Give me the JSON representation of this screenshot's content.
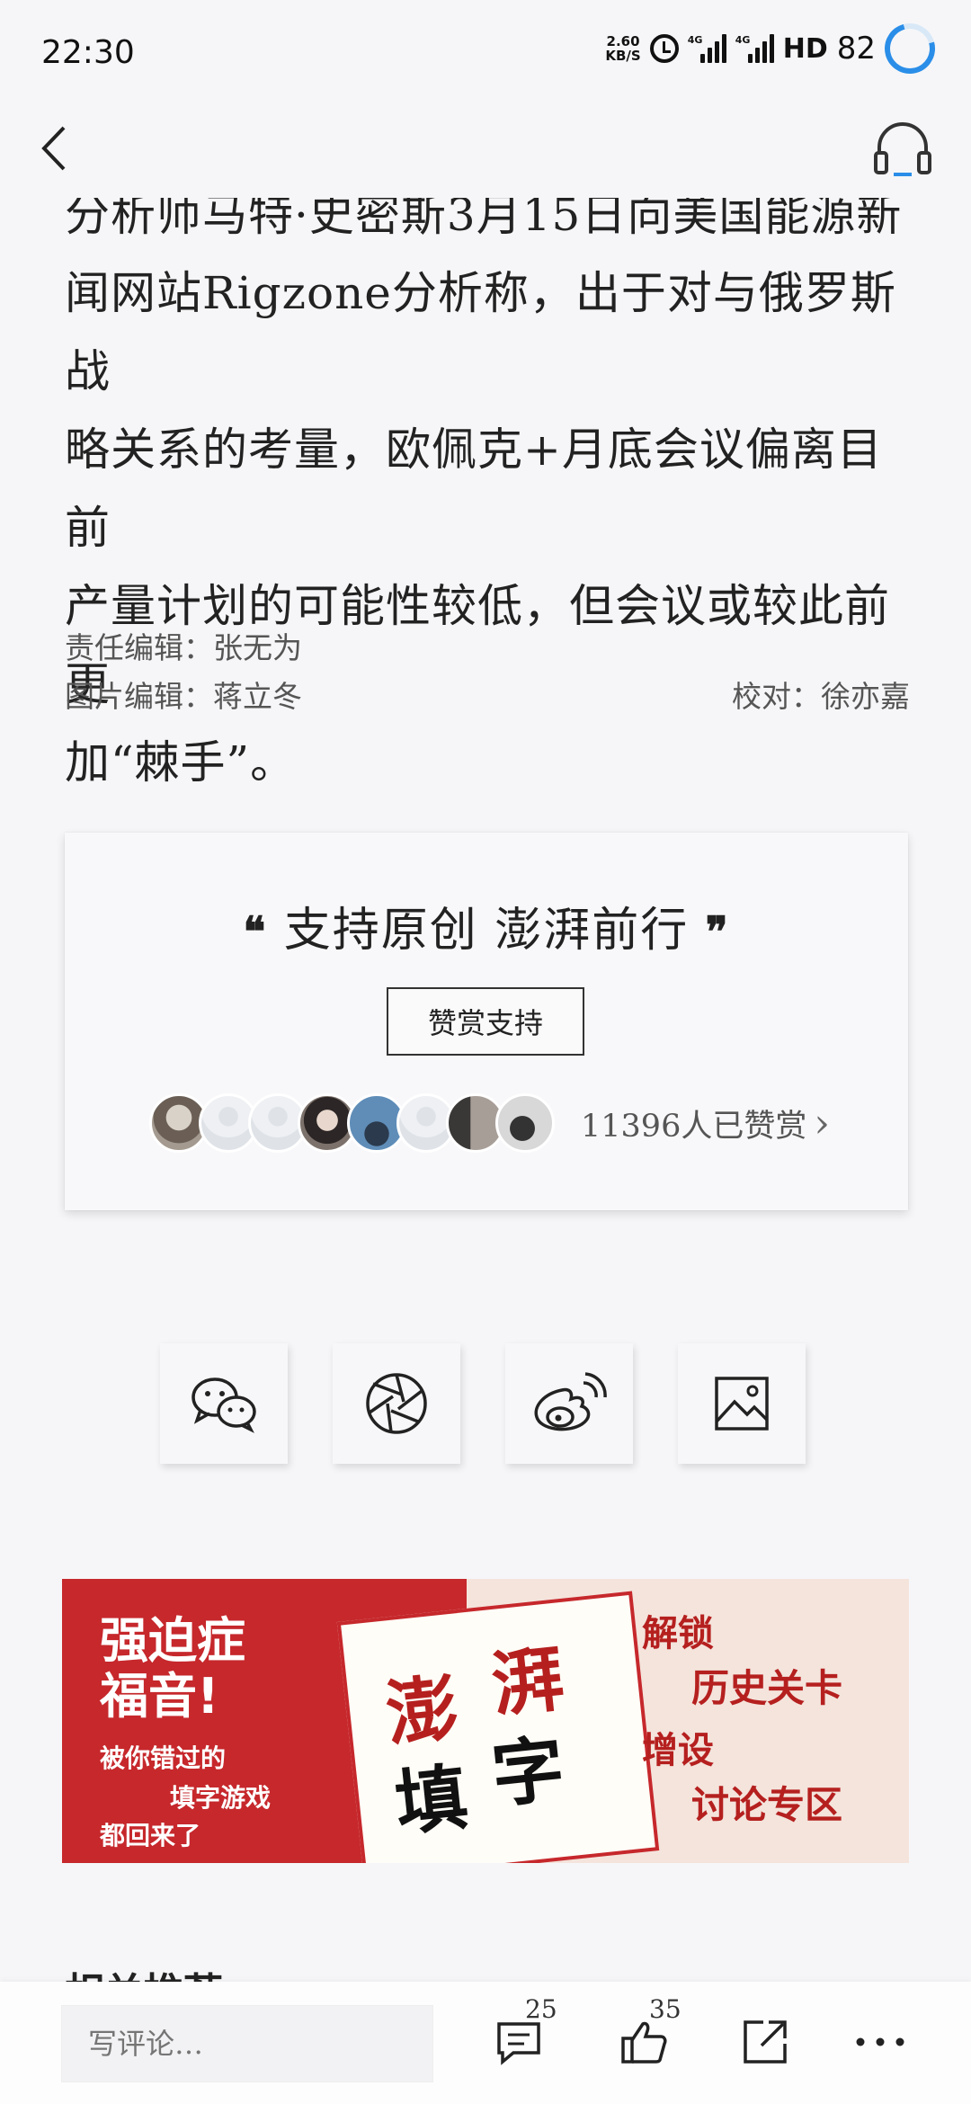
{
  "status_bar": {
    "time": "22:30",
    "net_speed_value": "2.60",
    "net_speed_unit": "KB/S",
    "signal_tag_1": "4G",
    "signal_tag_2": "4G",
    "hd_label": "HD",
    "battery": "82"
  },
  "nav": {
    "back_icon": "chevron-left-icon",
    "listen_icon": "headphones-icon"
  },
  "article": {
    "paragraph_lines": [
      "分析师马特·史密斯3月15日向美国能源新",
      "闻网站Rigzone分析称，出于对与俄罗斯战",
      "略关系的考量，欧佩克+月底会议偏离目前",
      "产量计划的可能性较低，但会议或较此前更",
      "加“棘手”。"
    ]
  },
  "credits": {
    "editor": "责任编辑：张无为",
    "photo_editor": "图片编辑：蒋立冬",
    "proofreader": "校对：徐亦嘉"
  },
  "reward": {
    "slogan": "支持原创  澎湃前行",
    "open_quote": "❝",
    "close_quote": "❞",
    "button_label": "赞赏支持",
    "donor_count": "11396人已赞赏",
    "chevron": "›"
  },
  "share": {
    "items": [
      "wechat-icon",
      "moments-icon",
      "weibo-icon",
      "image-icon"
    ]
  },
  "banner": {
    "headline_1": "强迫症",
    "headline_2": "福音!",
    "line_1": "被你错过的",
    "line_2": "填字游戏",
    "line_3": "都回来了",
    "book_char_1": "澎",
    "book_char_2": "湃",
    "book_char_3": "填",
    "book_char_4": "字",
    "right_1": "解锁",
    "right_2": "历史关卡",
    "right_3": "增设",
    "right_4": "讨论专区"
  },
  "related": {
    "title": "相关推荐"
  },
  "bottom_bar": {
    "comment_placeholder": "写评论…",
    "comment_count": "25",
    "like_count": "35"
  },
  "colors": {
    "accent_blue": "#2a8ee8",
    "banner_red": "#c6282c",
    "background": "#f6f6f8"
  }
}
